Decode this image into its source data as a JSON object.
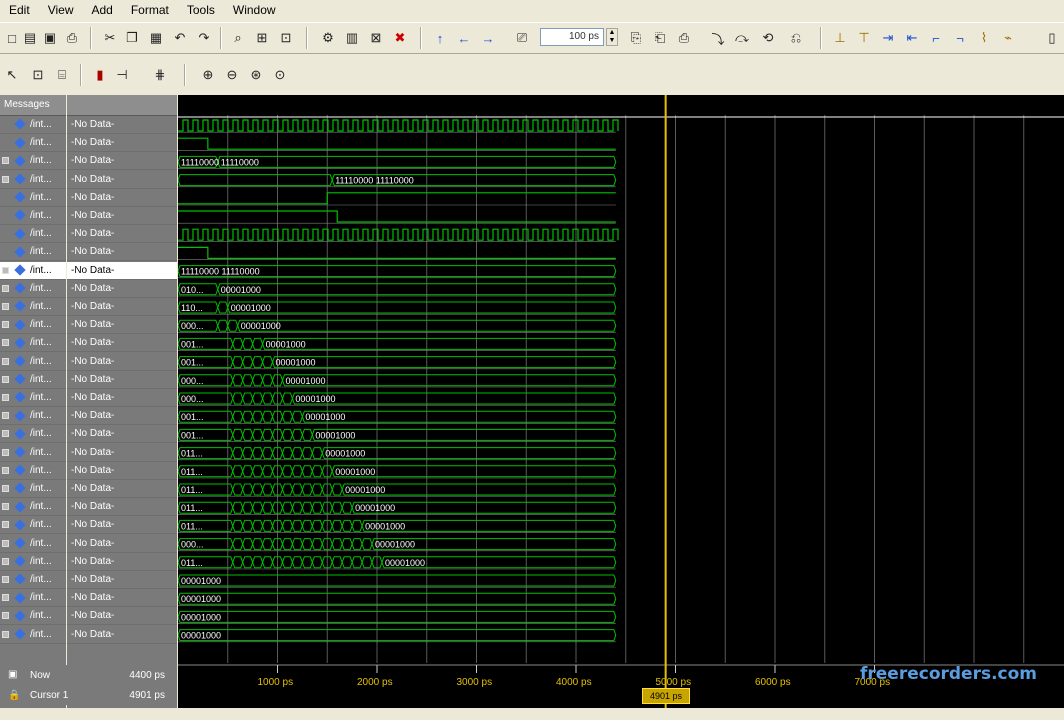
{
  "menu": [
    "Edit",
    "View",
    "Add",
    "Format",
    "Tools",
    "Window"
  ],
  "toolbar": {
    "zoom_value": "100 ps"
  },
  "panel": {
    "messages_header": "Messages"
  },
  "signals": [
    {
      "name": "/int...",
      "value": "-No Data-",
      "expand": false,
      "selected": false
    },
    {
      "name": "/int...",
      "value": "-No Data-",
      "expand": false,
      "selected": false
    },
    {
      "name": "/int...",
      "value": "-No Data-",
      "expand": true,
      "selected": false
    },
    {
      "name": "/int...",
      "value": "-No Data-",
      "expand": true,
      "selected": false
    },
    {
      "name": "/int...",
      "value": "-No Data-",
      "expand": false,
      "selected": false
    },
    {
      "name": "/int...",
      "value": "-No Data-",
      "expand": false,
      "selected": false
    },
    {
      "name": "/int...",
      "value": "-No Data-",
      "expand": false,
      "selected": false
    },
    {
      "name": "/int...",
      "value": "-No Data-",
      "expand": false,
      "selected": false
    },
    {
      "name": "/int...",
      "value": "-No Data-",
      "expand": true,
      "selected": true
    },
    {
      "name": "/int...",
      "value": "-No Data-",
      "expand": true,
      "selected": false
    },
    {
      "name": "/int...",
      "value": "-No Data-",
      "expand": true,
      "selected": false
    },
    {
      "name": "/int...",
      "value": "-No Data-",
      "expand": true,
      "selected": false
    },
    {
      "name": "/int...",
      "value": "-No Data-",
      "expand": true,
      "selected": false
    },
    {
      "name": "/int...",
      "value": "-No Data-",
      "expand": true,
      "selected": false
    },
    {
      "name": "/int...",
      "value": "-No Data-",
      "expand": true,
      "selected": false
    },
    {
      "name": "/int...",
      "value": "-No Data-",
      "expand": true,
      "selected": false
    },
    {
      "name": "/int...",
      "value": "-No Data-",
      "expand": true,
      "selected": false
    },
    {
      "name": "/int...",
      "value": "-No Data-",
      "expand": true,
      "selected": false
    },
    {
      "name": "/int...",
      "value": "-No Data-",
      "expand": true,
      "selected": false
    },
    {
      "name": "/int...",
      "value": "-No Data-",
      "expand": true,
      "selected": false
    },
    {
      "name": "/int...",
      "value": "-No Data-",
      "expand": true,
      "selected": false
    },
    {
      "name": "/int...",
      "value": "-No Data-",
      "expand": true,
      "selected": false
    },
    {
      "name": "/int...",
      "value": "-No Data-",
      "expand": true,
      "selected": false
    },
    {
      "name": "/int...",
      "value": "-No Data-",
      "expand": true,
      "selected": false
    },
    {
      "name": "/int...",
      "value": "-No Data-",
      "expand": true,
      "selected": false
    },
    {
      "name": "/int...",
      "value": "-No Data-",
      "expand": true,
      "selected": false
    },
    {
      "name": "/int...",
      "value": "-No Data-",
      "expand": true,
      "selected": false
    },
    {
      "name": "/int...",
      "value": "-No Data-",
      "expand": true,
      "selected": false
    },
    {
      "name": "/int...",
      "value": "-No Data-",
      "expand": true,
      "selected": false
    }
  ],
  "wave_values": [
    {
      "row": 2,
      "labels": [
        "11110000",
        "11110000"
      ]
    },
    {
      "row": 3,
      "labels": [
        "11110000 11110000"
      ]
    },
    {
      "row": 8,
      "labels": [
        "11110000 11110000"
      ]
    },
    {
      "row": 9,
      "labels": [
        "010...",
        "00001000"
      ]
    },
    {
      "row": 10,
      "labels": [
        "110...",
        "00001000"
      ]
    },
    {
      "row": 11,
      "labels": [
        "000...",
        "00001000"
      ]
    },
    {
      "row": 12,
      "labels": [
        "001...",
        "00001000"
      ]
    },
    {
      "row": 13,
      "labels": [
        "001...",
        "00001000"
      ]
    },
    {
      "row": 14,
      "labels": [
        "000...",
        "00001000"
      ]
    },
    {
      "row": 15,
      "labels": [
        "000...",
        "00001000"
      ]
    },
    {
      "row": 16,
      "labels": [
        "001...",
        "00001000"
      ]
    },
    {
      "row": 17,
      "labels": [
        "001...",
        "00001000"
      ]
    },
    {
      "row": 18,
      "labels": [
        "011...",
        "00001000"
      ]
    },
    {
      "row": 19,
      "labels": [
        "011...",
        "00001000"
      ]
    },
    {
      "row": 20,
      "labels": [
        "011...",
        "00001000"
      ]
    },
    {
      "row": 21,
      "labels": [
        "011...",
        "00001000"
      ]
    },
    {
      "row": 22,
      "labels": [
        "011...",
        "00001000"
      ]
    },
    {
      "row": 23,
      "labels": [
        "000...",
        "00001000"
      ]
    },
    {
      "row": 24,
      "labels": [
        "011...",
        "00001000"
      ]
    },
    {
      "row": 25,
      "labels": [
        "00001000"
      ]
    },
    {
      "row": 26,
      "labels": [
        "00001000"
      ]
    },
    {
      "row": 27,
      "labels": [
        "00001000"
      ]
    },
    {
      "row": 28,
      "labels": [
        "00001000"
      ]
    }
  ],
  "timeline": {
    "ticks": [
      "1000 ps",
      "2000 ps",
      "3000 ps",
      "4000 ps",
      "5000 ps",
      "6000 ps",
      "7000 ps"
    ],
    "now_label": "Now",
    "now_value": "4400 ps",
    "cursor_label": "Cursor 1",
    "cursor_value": "4901 ps",
    "cursor_marker": "4901 ps",
    "sim_end_ps": 4400,
    "cursor_ps": 4901
  },
  "watermark": "freerecorders.com",
  "colors": {
    "wave": "#00c000",
    "cursor": "#e6c000",
    "wave_bg": "#000000",
    "signal_icon": "#3a6fe0"
  }
}
